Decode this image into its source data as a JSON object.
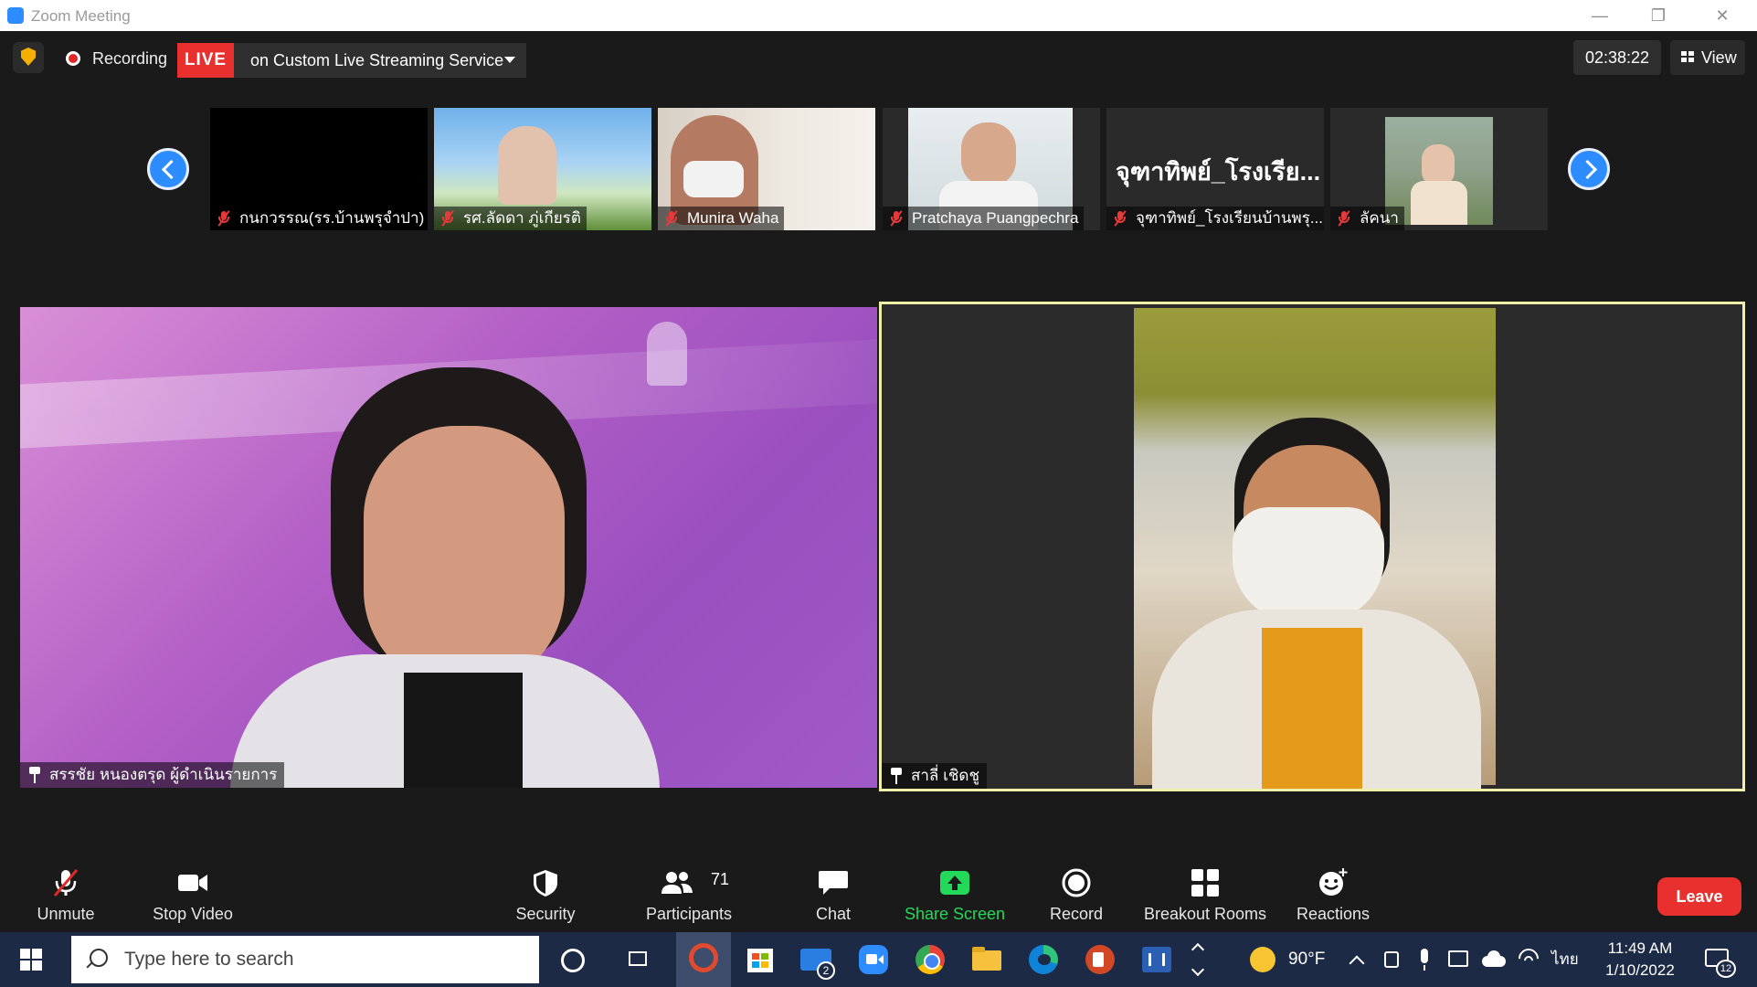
{
  "window": {
    "title": "Zoom Meeting"
  },
  "topbar": {
    "recording_label": "Recording",
    "live_badge": "LIVE",
    "live_service": "on Custom Live Streaming Service",
    "timer": "02:38:22",
    "view_label": "View"
  },
  "thumbnails": [
    {
      "name": "กนกวรรณ(รร.บ้านพรุจำปา)",
      "muted": true
    },
    {
      "name": "รศ.ลัดดา ภู่เกียรติ",
      "muted": true
    },
    {
      "name": "Munira Waha",
      "muted": true
    },
    {
      "name": "Pratchaya Puangpechra",
      "muted": true
    },
    {
      "name": "จุฑาทิพย์_โรงเรียนบ้านพรุ...",
      "big_name": "จุฑาทิพย์_โรงเรีย...",
      "muted": true
    },
    {
      "name": "ลัคนา",
      "muted": true
    }
  ],
  "main_videos": [
    {
      "name": "สรรชัย หนองตรุด ผู้ดำเนินรายการ"
    },
    {
      "name": "สาลี่ เชิดชู"
    }
  ],
  "toolbar": {
    "unmute": "Unmute",
    "stop_video": "Stop Video",
    "security": "Security",
    "participants": "Participants",
    "participants_count": "71",
    "chat": "Chat",
    "share_screen": "Share Screen",
    "record": "Record",
    "breakout_rooms": "Breakout Rooms",
    "reactions": "Reactions",
    "leave": "Leave"
  },
  "taskbar": {
    "search_placeholder": "Type here to search",
    "mail_badge": "2",
    "weather": "90°F",
    "language": "ไทย",
    "time": "11:49 AM",
    "date": "1/10/2022",
    "notifications": "12"
  },
  "colors": {
    "live_red": "#e8312f",
    "accent_blue": "#2d8cff",
    "share_green": "#23d959",
    "active_border": "#f1f0a8"
  }
}
